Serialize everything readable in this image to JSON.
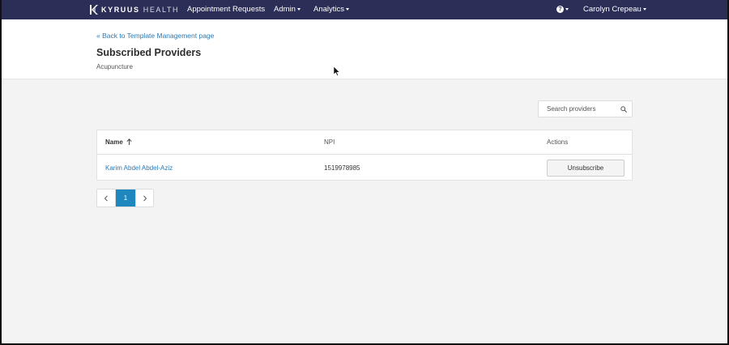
{
  "navbar": {
    "logo_bold": "KYRUUS",
    "logo_light": "HEALTH",
    "items": [
      {
        "label": "Appointment Requests",
        "dropdown": false
      },
      {
        "label": "Admin",
        "dropdown": true
      },
      {
        "label": "Analytics",
        "dropdown": true
      }
    ],
    "help_glyph": "?",
    "user_name": "Carolyn Crepeau",
    "color": "#2b2e57"
  },
  "header": {
    "back_link": "« Back to Template Management page",
    "title": "Subscribed Providers",
    "subtitle": "Acupuncture"
  },
  "search": {
    "placeholder": "Search providers",
    "icon": "search-icon"
  },
  "table": {
    "columns": [
      "Name",
      "NPI",
      "Actions"
    ],
    "sort_icon": "arrow-up-icon",
    "rows": [
      {
        "name": "Karim Abdel Abdel-Aziz",
        "npi": "1519978985",
        "action_label": "Unsubscribe"
      }
    ]
  },
  "pagination": {
    "current_page": "1",
    "accent": "#1e87bd"
  }
}
